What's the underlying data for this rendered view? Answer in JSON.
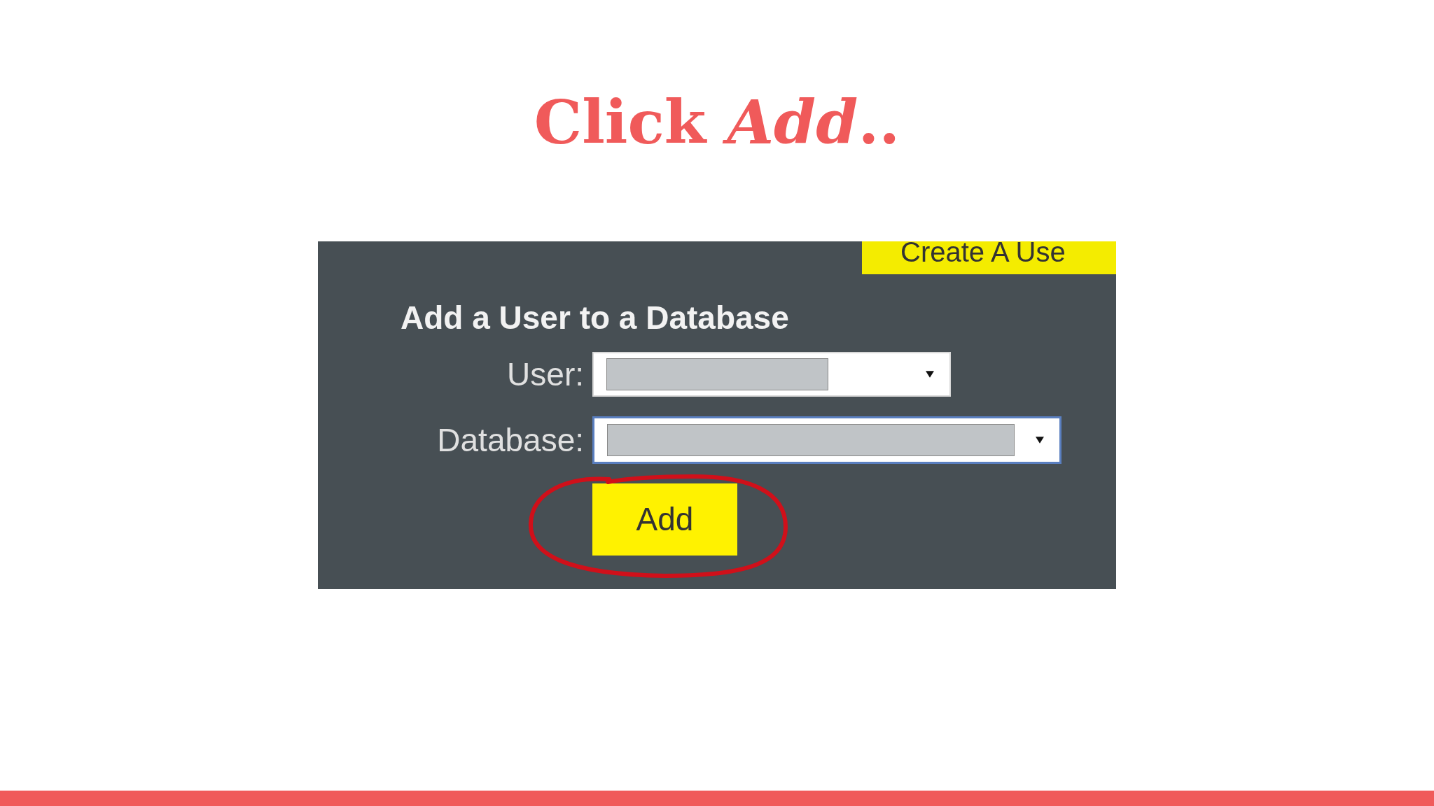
{
  "title": "Click *Add*..",
  "panel": {
    "tab_label": "Create A Use",
    "heading": "Add a User to a Database",
    "fields": [
      {
        "label": "User:"
      },
      {
        "label": "Database:"
      }
    ],
    "button": "Add"
  }
}
